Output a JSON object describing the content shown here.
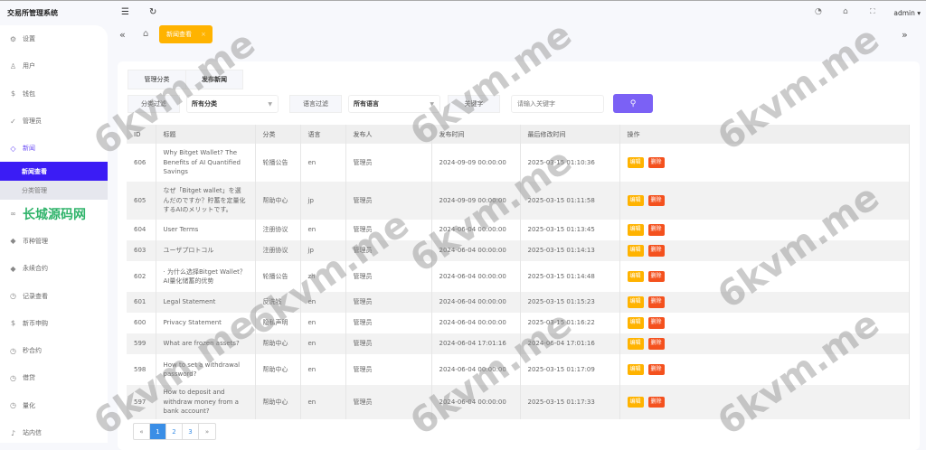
{
  "app": {
    "title": "交易所管理系统",
    "user": "admin"
  },
  "sidebar": {
    "items": [
      {
        "label": "设置",
        "icon": "gear-icon"
      },
      {
        "label": "用户",
        "icon": "user-icon"
      },
      {
        "label": "钱包",
        "icon": "wallet-icon"
      },
      {
        "label": "管理员",
        "icon": "shield-icon"
      },
      {
        "label": "新闻",
        "icon": "tag-icon"
      }
    ],
    "sub": [
      {
        "label": "新闻查看"
      },
      {
        "label": "分类管理"
      }
    ],
    "items2": [
      {
        "label": "长城源码网",
        "icon": "link-icon"
      },
      {
        "label": "币种管理",
        "icon": "diamond-icon"
      },
      {
        "label": "永续合约",
        "icon": "diamond-icon"
      },
      {
        "label": "记录查看",
        "icon": "clock-icon"
      },
      {
        "label": "新币申购",
        "icon": "coin-icon"
      },
      {
        "label": "秒合约",
        "icon": "clock-icon"
      },
      {
        "label": "借贷",
        "icon": "clock-icon"
      },
      {
        "label": "量化",
        "icon": "clock-icon"
      },
      {
        "label": "站内信",
        "icon": "bell-icon"
      }
    ]
  },
  "tabs": {
    "active": "新闻查看"
  },
  "toolbar": {
    "manage_category": "管理分类",
    "publish_news": "发布新闻"
  },
  "filters": {
    "category_label": "分类过滤",
    "category_value": "所有分类",
    "language_label": "语言过滤",
    "language_value": "所有语言",
    "keyword_label": "关键字",
    "keyword_placeholder": "请输入关键字"
  },
  "table": {
    "headers": [
      "ID",
      "标题",
      "分类",
      "语言",
      "发布人",
      "发布时间",
      "最后修改时间",
      "操作"
    ],
    "edit": "编辑",
    "delete": "删除",
    "rows": [
      [
        "606",
        "Why Bitget Wallet? The Benefits of AI Quantified Savings",
        "轮播公告",
        "en",
        "管理员",
        "2024-09-09 00:00:00",
        "2025-03-15 01:10:36"
      ],
      [
        "605",
        "なぜ「Bitget wallet」を選んだのですか？貯蓄を定量化するAIのメリットです。",
        "帮助中心",
        "jp",
        "管理员",
        "2024-09-09 00:00:00",
        "2025-03-15 01:11:58"
      ],
      [
        "604",
        "User Terms",
        "注册协议",
        "en",
        "管理员",
        "2024-06-04 00:00:00",
        "2025-03-15 01:13:45"
      ],
      [
        "603",
        "ユーザプロトコル",
        "注册协议",
        "jp",
        "管理员",
        "2024-06-04 00:00:00",
        "2025-03-15 01:14:13"
      ],
      [
        "602",
        "· 为什么选择Bitget Wallet？AI量化储蓄的优势",
        "轮播公告",
        "zh",
        "管理员",
        "2024-06-04 00:00:00",
        "2025-03-15 01:14:48"
      ],
      [
        "601",
        "Legal Statement",
        "反洗钱",
        "en",
        "管理员",
        "2024-06-04 00:00:00",
        "2025-03-15 01:15:23"
      ],
      [
        "600",
        "Privacy Statement",
        "隐私声明",
        "en",
        "管理员",
        "2024-06-04 00:00:00",
        "2025-03-15 01:16:22"
      ],
      [
        "599",
        "What are frozen assets?",
        "帮助中心",
        "en",
        "管理员",
        "2024-06-04 17:01:16",
        "2024-06-04 17:01:16"
      ],
      [
        "598",
        "How to set a withdrawal password?",
        "帮助中心",
        "en",
        "管理员",
        "2024-06-04 00:00:00",
        "2025-03-15 01:17:09"
      ],
      [
        "597",
        "How to deposit and withdraw money from a bank account?",
        "帮助中心",
        "en",
        "管理员",
        "2024-06-04 00:00:00",
        "2025-03-15 01:17:33"
      ]
    ]
  },
  "pagination": {
    "prev": "«",
    "pages": [
      "1",
      "2",
      "3"
    ],
    "next": "»"
  },
  "watermark": "6kvm.me"
}
